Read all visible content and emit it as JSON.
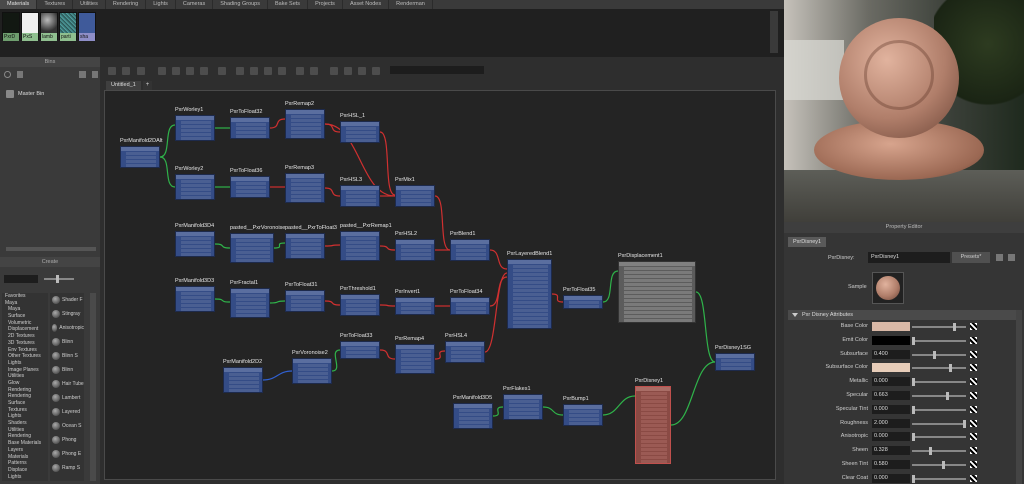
{
  "top_tabs": [
    "Materials",
    "Textures",
    "Utilities",
    "Rendering",
    "Lights",
    "Cameras",
    "Shading Groups",
    "Bake Sets",
    "Projects",
    "Asset Nodes",
    "Renderman"
  ],
  "swatches": [
    {
      "label": "PxrD",
      "color": "#121812"
    },
    {
      "label": "PxS",
      "color": "#f0f0f0"
    },
    {
      "label": "lamb",
      "color": "#777777"
    },
    {
      "label": "parti",
      "color": "#2d6e62"
    },
    {
      "label": "sha",
      "color": "#3f5a9a"
    }
  ],
  "bins": {
    "title": "Bins",
    "master": "Master Bin"
  },
  "create": {
    "title": "Create",
    "categories": [
      "Favorites",
      "Maya",
      "Maya",
      "Surface",
      "Volumetric",
      "Displacement",
      "2D Textures",
      "3D Textures",
      "Env Textures",
      "Other Textures",
      "Lights",
      "Image Planes",
      "Utilities",
      "Glow",
      "Rendering",
      "Rendering",
      "Surface",
      "Textures",
      "Lights",
      "Shaders",
      "Utilities",
      "Rendering",
      "Base Materials",
      "Layers",
      "Materials",
      "Patterns",
      "Displace",
      "Lights"
    ],
    "shaders": [
      "Shader F",
      "Stingray",
      "Anisotropic",
      "Blinn",
      "Blinn S",
      "Blinn",
      "Hair Tube",
      "Lambert",
      "Layered",
      "Ocean S",
      "Phong",
      "Phong E",
      "Ramp S"
    ]
  },
  "editor": {
    "tab": "Untitled_1",
    "add_tab": "+"
  },
  "nodes": [
    {
      "id": "m2d",
      "label": "PxrManifold2DAlt",
      "rows": 4
    },
    {
      "id": "w1",
      "label": "PxrWorley1",
      "rows": 5
    },
    {
      "id": "w2",
      "label": "PxrWorley2",
      "rows": 5
    },
    {
      "id": "tf32",
      "label": "PxrToFloat32",
      "rows": 4
    },
    {
      "id": "tf36",
      "label": "PxrToFloat36",
      "rows": 4
    },
    {
      "id": "r2",
      "label": "PxrRemap2",
      "rows": 6
    },
    {
      "id": "r3",
      "label": "PxrRemap3",
      "rows": 6
    },
    {
      "id": "hsl1",
      "label": "PxrHSL_1",
      "rows": 4
    },
    {
      "id": "hsl3",
      "label": "PxrHSL3",
      "rows": 4
    },
    {
      "id": "mix1",
      "label": "PxrMix1",
      "rows": 4
    },
    {
      "id": "m3d4",
      "label": "PxrManifold3D4",
      "rows": 5
    },
    {
      "id": "pv",
      "label": "pasted__PxrVoronoise",
      "rows": 6
    },
    {
      "id": "ptf",
      "label": "pasted__PxrToFloat3",
      "rows": 5
    },
    {
      "id": "pr1",
      "label": "pasted__PxrRemap1",
      "rows": 6
    },
    {
      "id": "hsl2",
      "label": "PxrHSL2",
      "rows": 4
    },
    {
      "id": "bl1",
      "label": "PxrBlend1",
      "rows": 4
    },
    {
      "id": "lb1",
      "label": "PxrLayeredBlend1",
      "rows": 16
    },
    {
      "id": "m3d3",
      "label": "PxrManifold3D3",
      "rows": 5
    },
    {
      "id": "fr1",
      "label": "PxrFractal1",
      "rows": 6
    },
    {
      "id": "tf31",
      "label": "PxrToFloat31",
      "rows": 4
    },
    {
      "id": "th1",
      "label": "PxrThreshold1",
      "rows": 4
    },
    {
      "id": "inv1",
      "label": "PxrInvert1",
      "rows": 3
    },
    {
      "id": "tf34",
      "label": "PxrToFloat34",
      "rows": 3
    },
    {
      "id": "tf35",
      "label": "PxrToFloat35",
      "rows": 2
    },
    {
      "id": "pd1",
      "label": "PxrDisplacement1",
      "rows": 14
    },
    {
      "id": "tf33",
      "label": "PxrToFloat33",
      "rows": 3
    },
    {
      "id": "hsl4",
      "label": "PxrHSL4",
      "rows": 4
    },
    {
      "id": "r4",
      "label": "PxrRemap4",
      "rows": 6
    },
    {
      "id": "vo2",
      "label": "PxrVoronoise2",
      "rows": 5
    },
    {
      "id": "m2d2",
      "label": "PxrManifold2D2",
      "rows": 5
    },
    {
      "id": "m3d5",
      "label": "PxrManifold3D5",
      "rows": 5
    },
    {
      "id": "fl1",
      "label": "PxrFlakes1",
      "rows": 5
    },
    {
      "id": "bu1",
      "label": "PxrBump1",
      "rows": 4
    },
    {
      "id": "di1",
      "label": "PxrDisney1",
      "rows": 18
    },
    {
      "id": "dsg",
      "label": "PxrDisney1SG",
      "rows": 3
    }
  ],
  "preview": {
    "sphere_color": "#b07e6a"
  },
  "property_editor": {
    "title": "Property Editor",
    "tab": "PxrDisney1",
    "node_type_label": "PxrDisney:",
    "node_name": "PxrDisney1",
    "presets_label": "Presets*",
    "sample_label": "Sample",
    "section": "Pxr Disney Attributes",
    "attributes": [
      {
        "label": "Base Color",
        "kind": "color",
        "color": "#d9b8a6",
        "slider": 0.78
      },
      {
        "label": "Emit Color",
        "kind": "color",
        "color": "#000000",
        "slider": 0.0
      },
      {
        "label": "Subsurface",
        "kind": "value",
        "value": "0.400",
        "slider": 0.4
      },
      {
        "label": "Subsurface Color",
        "kind": "color",
        "color": "#e7cdb9",
        "slider": 0.72
      },
      {
        "label": "Metallic",
        "kind": "value",
        "value": "0.000",
        "slider": 0.0
      },
      {
        "label": "Specular",
        "kind": "value",
        "value": "0.663",
        "slider": 0.66
      },
      {
        "label": "Specular Tint",
        "kind": "value",
        "value": "0.000",
        "slider": 0.0
      },
      {
        "label": "Roughness",
        "kind": "value",
        "value": "2.000",
        "slider": 0.98
      },
      {
        "label": "Anisotropic",
        "kind": "value",
        "value": "0.000",
        "slider": 0.0
      },
      {
        "label": "Sheen",
        "kind": "value",
        "value": "0.328",
        "slider": 0.33
      },
      {
        "label": "Sheen Tint",
        "kind": "value",
        "value": "0.580",
        "slider": 0.58
      },
      {
        "label": "Clear Coat",
        "kind": "value",
        "value": "0.000",
        "slider": 0.0
      }
    ]
  }
}
